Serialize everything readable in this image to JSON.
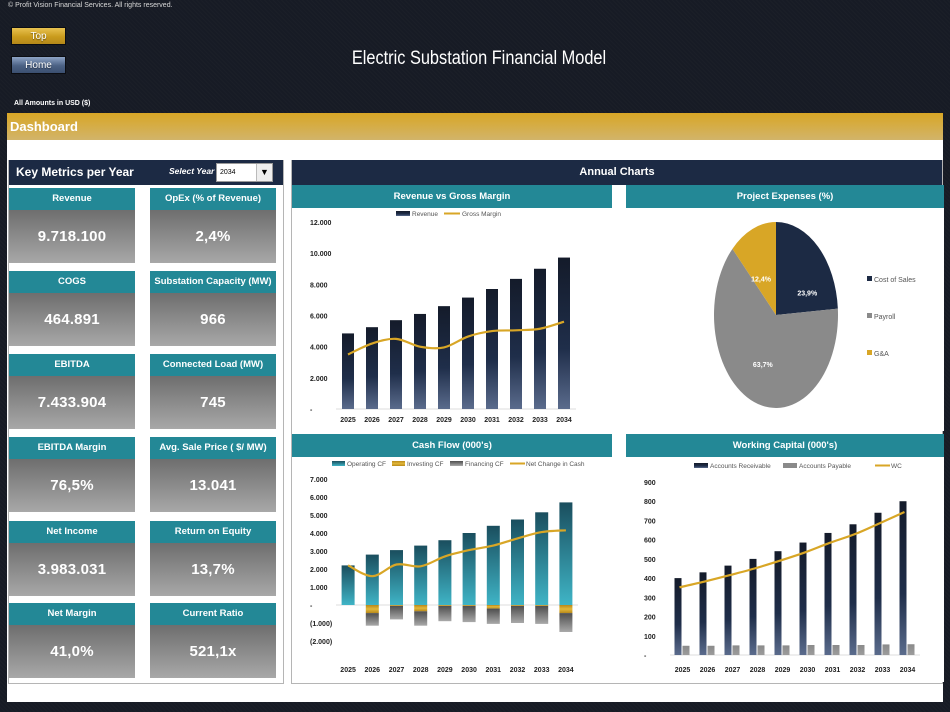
{
  "copyright": "© Profit Vision Financial Services. All rights reserved.",
  "nav": {
    "top_label": "Top",
    "home_label": "Home"
  },
  "app_title": "Electric Substation Financial Model",
  "amounts_note": "All Amounts in  USD ($)",
  "section_title": "Dashboard",
  "key_metrics": {
    "title": "Key Metrics per Year",
    "select_year_label": "Select Year",
    "selected_year": "2034",
    "cards": [
      {
        "label": "Revenue",
        "value": "9.718.100"
      },
      {
        "label": "OpEx (% of Revenue)",
        "value": "2,4%"
      },
      {
        "label": "COGS",
        "value": "464.891"
      },
      {
        "label": "Substation Capacity (MW)",
        "value": "966"
      },
      {
        "label": "EBITDA",
        "value": "7.433.904"
      },
      {
        "label": "Connected Load (MW)",
        "value": "745"
      },
      {
        "label": "EBITDA Margin",
        "value": "76,5%"
      },
      {
        "label": "Avg. Sale Price ( $/ MW)",
        "value": "13.041"
      },
      {
        "label": "Net Income",
        "value": "3.983.031"
      },
      {
        "label": "Return on Equity",
        "value": "13,7%"
      },
      {
        "label": "Net Margin",
        "value": "41,0%"
      },
      {
        "label": "Current Ratio",
        "value": "521,1x"
      }
    ]
  },
  "annual_charts_title": "Annual Charts",
  "colors": {
    "navy": "#1c2a44",
    "teal": "#238896",
    "gold": "#d8a626",
    "gray": "#8a8a8a"
  },
  "chart_data": [
    {
      "id": "revenue",
      "type": "bar",
      "title": "Revenue vs Gross Margin",
      "categories": [
        "2025",
        "2026",
        "2027",
        "2028",
        "2029",
        "2030",
        "2031",
        "2032",
        "2033",
        "2034"
      ],
      "series": [
        {
          "name": "Revenue",
          "kind": "bar",
          "values": [
            4850,
            5250,
            5700,
            6100,
            6600,
            7150,
            7700,
            8350,
            9000,
            9718
          ]
        },
        {
          "name": "Gross Margin",
          "kind": "line",
          "values": [
            3500,
            4200,
            4500,
            4000,
            3950,
            4650,
            5000,
            5050,
            5150,
            5600
          ]
        }
      ],
      "ylim": [
        0,
        12000
      ],
      "yticks": [
        0,
        2000,
        4000,
        6000,
        8000,
        10000,
        12000
      ],
      "ytick_labels": [
        "-",
        "2.000",
        "4.000",
        "6.000",
        "8.000",
        "10.000",
        "12.000"
      ],
      "legend": "top"
    },
    {
      "id": "expenses",
      "type": "pie",
      "title": "Project Expenses (%)",
      "labels": [
        "Cost of Sales",
        "Payroll",
        "G&A"
      ],
      "values": [
        23.9,
        63.7,
        12.4
      ],
      "data_labels": [
        "23,9%",
        "63,7%",
        "12,4%"
      ],
      "legend": "right"
    },
    {
      "id": "cashflow",
      "type": "bar",
      "title": "Cash Flow (000's)",
      "categories": [
        "2025",
        "2026",
        "2027",
        "2028",
        "2029",
        "2030",
        "2031",
        "2032",
        "2033",
        "2034"
      ],
      "series": [
        {
          "name": "Operating CF",
          "kind": "bar",
          "values": [
            2200,
            2800,
            3050,
            3300,
            3600,
            4000,
            4400,
            4750,
            5150,
            5700
          ]
        },
        {
          "name": "Investing CF",
          "kind": "bar",
          "values": [
            0,
            -450,
            -50,
            -350,
            -50,
            -50,
            -200,
            -50,
            -50,
            -450
          ]
        },
        {
          "name": "Financing CF",
          "kind": "bar",
          "values": [
            0,
            -700,
            -750,
            -800,
            -850,
            -900,
            -850,
            -950,
            -1000,
            -1050
          ]
        },
        {
          "name": "Net Change in Cash",
          "kind": "line",
          "values": [
            2200,
            1600,
            2250,
            2150,
            2700,
            3050,
            3300,
            3700,
            4050,
            4150
          ]
        }
      ],
      "ylim": [
        -2000,
        7000
      ],
      "yticks": [
        -2000,
        -1000,
        0,
        1000,
        2000,
        3000,
        4000,
        5000,
        6000,
        7000
      ],
      "ytick_labels": [
        "(2.000)",
        "(1.000)",
        "-",
        "1.000",
        "2.000",
        "3.000",
        "4.000",
        "5.000",
        "6.000",
        "7.000"
      ],
      "legend": "top"
    },
    {
      "id": "workingcap",
      "type": "bar",
      "title": "Working Capital (000's)",
      "categories": [
        "2025",
        "2026",
        "2027",
        "2028",
        "2029",
        "2030",
        "2031",
        "2032",
        "2033",
        "2034"
      ],
      "series": [
        {
          "name": "Accounts Receivable",
          "kind": "bar",
          "values": [
            400,
            430,
            465,
            500,
            540,
            585,
            635,
            680,
            740,
            800
          ]
        },
        {
          "name": "Accounts Payable",
          "kind": "bar",
          "values": [
            48,
            48,
            50,
            50,
            50,
            52,
            52,
            52,
            55,
            56
          ]
        },
        {
          "name": "WC",
          "kind": "line",
          "values": [
            352,
            382,
            415,
            450,
            490,
            533,
            583,
            628,
            685,
            744
          ]
        }
      ],
      "ylim": [
        0,
        900
      ],
      "yticks": [
        0,
        100,
        200,
        300,
        400,
        500,
        600,
        700,
        800,
        900
      ],
      "ytick_labels": [
        "-",
        "100",
        "200",
        "300",
        "400",
        "500",
        "600",
        "700",
        "800",
        "900"
      ],
      "legend": "top"
    }
  ]
}
